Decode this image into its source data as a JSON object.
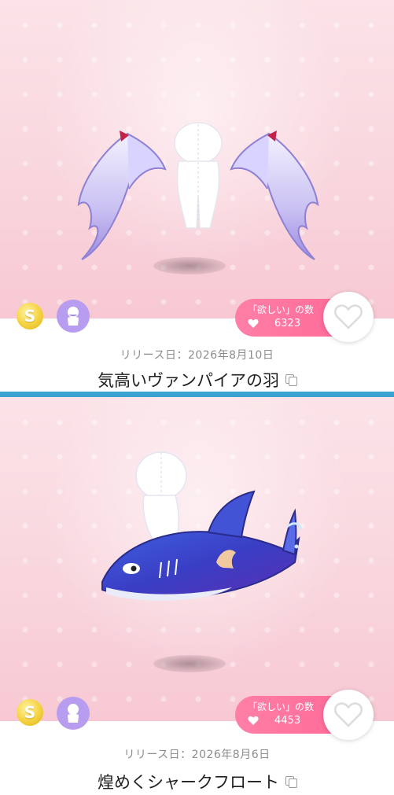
{
  "items": [
    {
      "release_label": "リリース日：2026年8月10日",
      "name": "気高いヴァンパイアの羽",
      "want_label": "「欲しい」の数",
      "want_count": "6323",
      "coin_letter": "S"
    },
    {
      "release_label": "リリース日：2026年8月6日",
      "name": "煌めくシャークフロート",
      "want_label": "「欲しい」の数",
      "want_count": "4453",
      "coin_letter": "S"
    }
  ],
  "colors": {
    "accent_pink": "#ff6b98",
    "divider_blue": "#3aa3cf",
    "avatar_purple": "#b79cf0",
    "coin_gold": "#f5d545"
  },
  "icons": {
    "coin": "coin-s-icon",
    "avatar": "avatar-icon",
    "heart_small": "heart-icon",
    "heart_button": "heart-outline-icon",
    "copy": "copy-icon"
  }
}
